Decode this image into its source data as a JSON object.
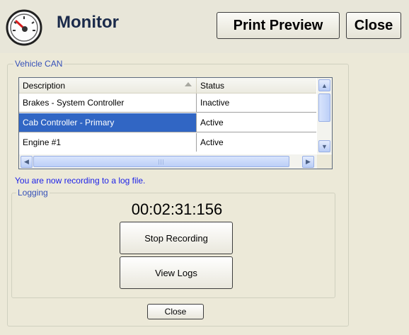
{
  "header": {
    "title": "Monitor",
    "print_preview_label": "Print Preview",
    "close_label": "Close",
    "icon": "gauge-icon"
  },
  "vehicle_can": {
    "legend": "Vehicle CAN",
    "columns": [
      "Description",
      "Status"
    ],
    "rows": [
      {
        "description": "Brakes - System Controller",
        "status": "Inactive",
        "selected": false
      },
      {
        "description": "Cab Controller - Primary",
        "status": "Active",
        "selected": true
      },
      {
        "description": "Engine #1",
        "status": "Active",
        "selected": false
      }
    ]
  },
  "recording_message": "You are now recording to a log file.",
  "logging": {
    "legend": "Logging",
    "timer": "00:02:31:156",
    "stop_label": "Stop Recording",
    "view_logs_label": "View Logs"
  },
  "footer": {
    "close_label": "Close"
  },
  "colors": {
    "background": "#ece9d8",
    "selection": "#3166c4",
    "legend_text": "#3550b8",
    "message_text": "#1e22e8"
  }
}
